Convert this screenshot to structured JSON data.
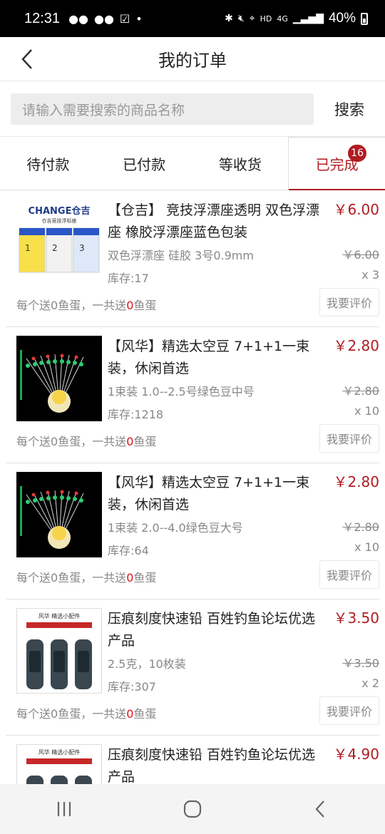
{
  "status_bar": {
    "time": "12:31",
    "battery": "40%",
    "network": "4G"
  },
  "header": {
    "title": "我的订单"
  },
  "search": {
    "placeholder": "请输入需要搜索的商品名称",
    "button": "搜索"
  },
  "tabs": [
    {
      "label": "待付款"
    },
    {
      "label": "已付款"
    },
    {
      "label": "等收货"
    },
    {
      "label": "已完成",
      "badge": "16",
      "active": true
    }
  ],
  "orders": [
    {
      "name": "【仓吉】 竞技浮漂座透明 双色浮漂座 橡胶浮漂座蓝色包装",
      "spec": "双色浮漂座 硅胶 3号0.9mm",
      "stock": "库存:17",
      "price": "￥6.00",
      "old_price": "￥6.00",
      "qty": "x 3",
      "gift_prefix": "每个送",
      "gift_each": "0",
      "gift_mid": "鱼蛋，一共送",
      "gift_total": "0",
      "gift_suffix": "鱼蛋",
      "review": "我要评价",
      "thumb": {
        "brand": "CHANGE仓吉",
        "caption": "仓吉竞技浮标座",
        "labels": [
          "1",
          "2",
          "3"
        ]
      }
    },
    {
      "name": "【风华】精选太空豆 7+1+1一束装，休闲首选",
      "spec": "1束装 1.0--2.5号绿色豆中号",
      "stock": "库存:1218",
      "price": "￥2.80",
      "old_price": "￥2.80",
      "qty": "x 10",
      "gift_prefix": "每个送",
      "gift_each": "0",
      "gift_mid": "鱼蛋，一共送",
      "gift_total": "0",
      "gift_suffix": "鱼蛋",
      "review": "我要评价"
    },
    {
      "name": "【风华】精选太空豆 7+1+1一束装，休闲首选",
      "spec": "1束装  2.0--4.0绿色豆大号",
      "stock": "库存:64",
      "price": "￥2.80",
      "old_price": "￥2.80",
      "qty": "x 10",
      "gift_prefix": "每个送",
      "gift_each": "0",
      "gift_mid": "鱼蛋，一共送",
      "gift_total": "0",
      "gift_suffix": "鱼蛋",
      "review": "我要评价"
    },
    {
      "name": "压痕刻度快速铅 百姓钓鱼论坛优选产品",
      "spec": "2.5克，10枚装",
      "stock": "库存:307",
      "price": "￥3.50",
      "old_price": "￥3.50",
      "qty": "x 2",
      "gift_prefix": "每个送",
      "gift_each": "0",
      "gift_mid": "鱼蛋，一共送",
      "gift_total": "0",
      "gift_suffix": "鱼蛋",
      "review": "我要评价",
      "thumb": {
        "brand": "风华  精选小配件"
      }
    },
    {
      "name": "压痕刻度快速铅 百姓钓鱼论坛优选产品",
      "price": "￥4.90",
      "thumb": {
        "brand": "风华  精选小配件"
      }
    }
  ]
}
